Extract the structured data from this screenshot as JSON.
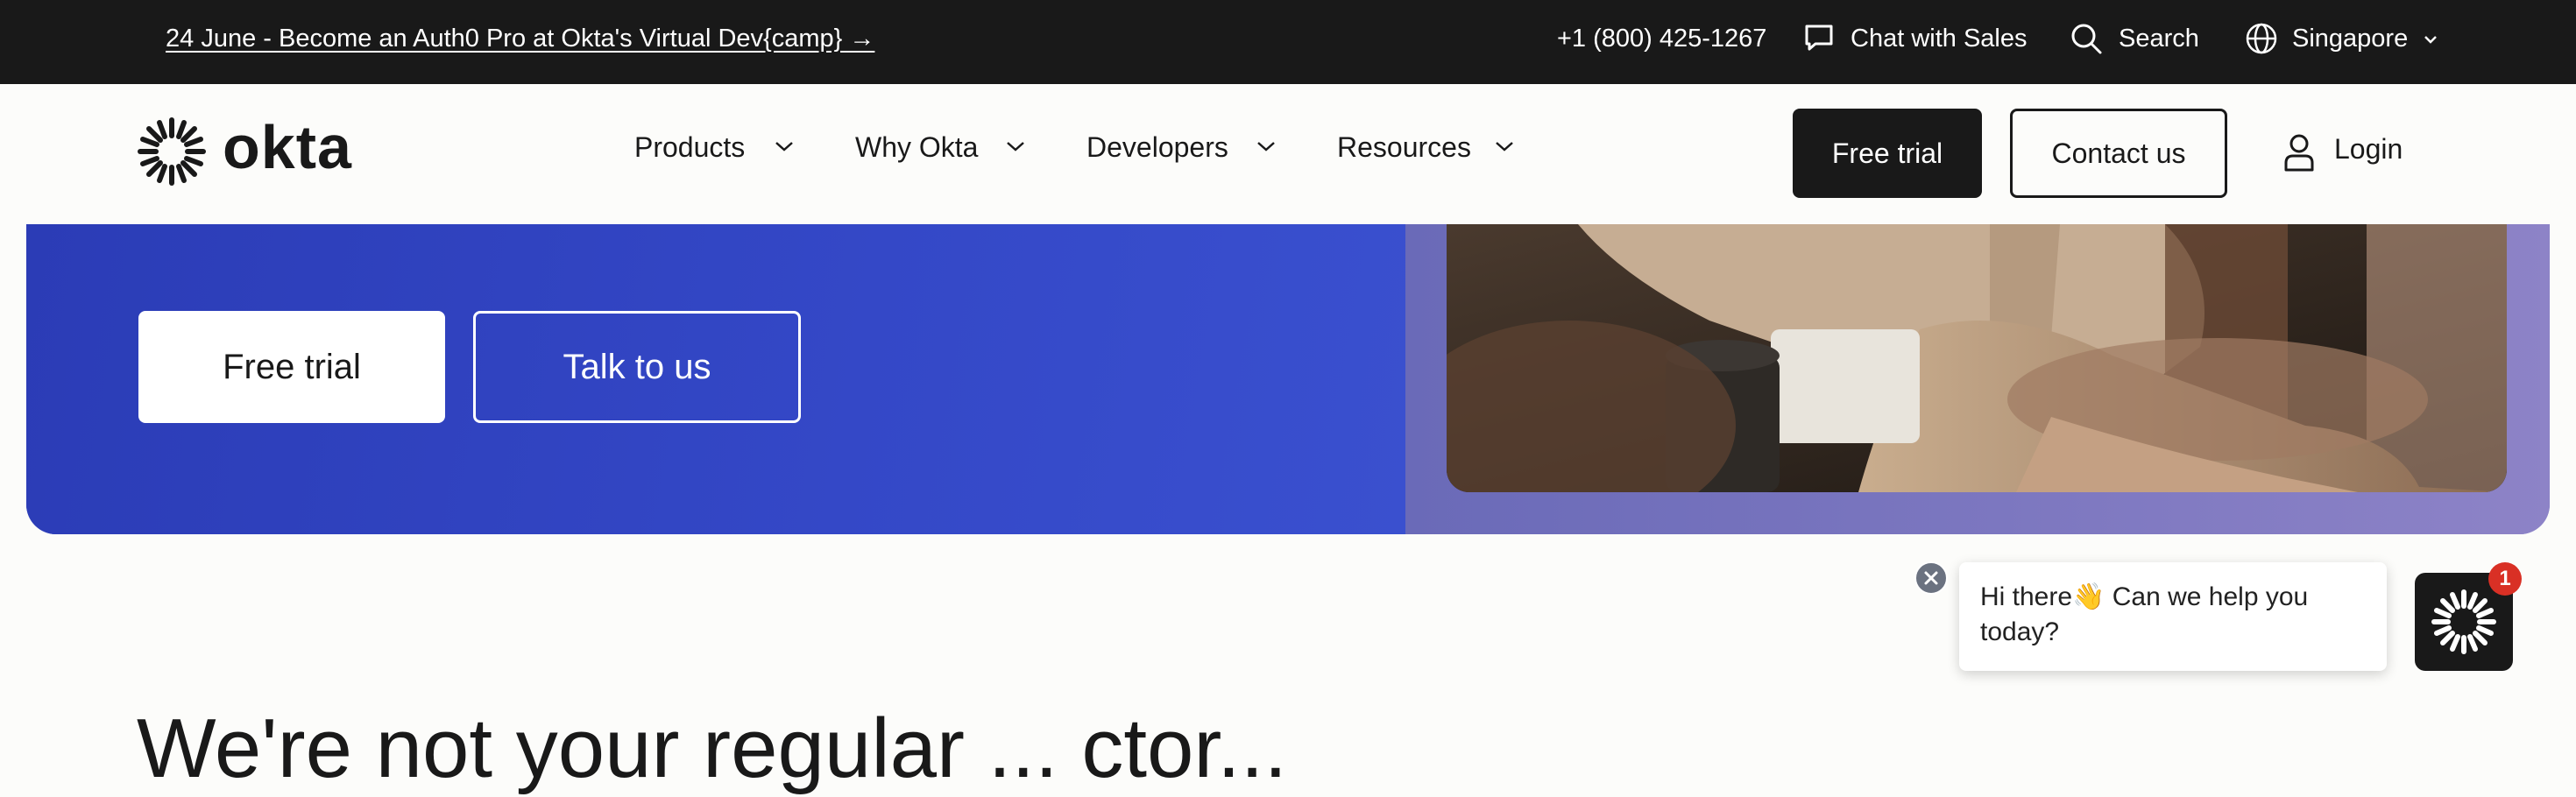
{
  "announcement": {
    "text": "24 June - Become an Auth0 Pro at Okta's Virtual Dev{camp} →"
  },
  "utility": {
    "phone": "+1 (800) 425-1267",
    "chat_label": "Chat with Sales",
    "search_label": "Search",
    "region_label": "Singapore"
  },
  "brand": {
    "name": "okta"
  },
  "nav": {
    "items": [
      {
        "label": "Products"
      },
      {
        "label": "Why Okta"
      },
      {
        "label": "Developers"
      },
      {
        "label": "Resources"
      }
    ],
    "free_trial": "Free trial",
    "contact": "Contact us",
    "login": "Login"
  },
  "hero": {
    "free_trial": "Free trial",
    "talk_to_us": "Talk to us"
  },
  "chat": {
    "message": "Hi there👋 Can we help you today?",
    "badge_count": "1"
  },
  "section": {
    "heading_partial": "We're not your regular ... ctor..."
  },
  "colors": {
    "topbar": "#191919",
    "hero_blue": "#3448c7",
    "accent_red": "#d93025"
  }
}
